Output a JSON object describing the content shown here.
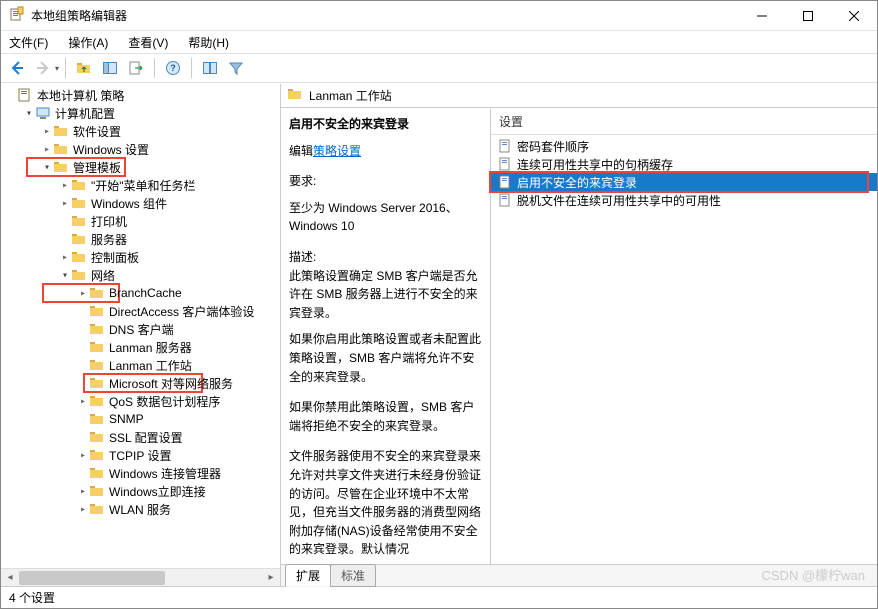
{
  "window": {
    "title": "本地组策略编辑器"
  },
  "menubar": {
    "file": "文件(F)",
    "action": "操作(A)",
    "view": "查看(V)",
    "help": "帮助(H)"
  },
  "tree": {
    "root": "本地计算机 策略",
    "computer_config": "计算机配置",
    "software_settings": "软件设置",
    "windows_settings": "Windows 设置",
    "admin_templates": "管理模板",
    "start_menu": "\"开始\"菜单和任务栏",
    "windows_components": "Windows 组件",
    "printers": "打印机",
    "server": "服务器",
    "control_panel": "控制面板",
    "network": "网络",
    "branchcache": "BranchCache",
    "directaccess": "DirectAccess 客户端体验设",
    "dns_client": "DNS 客户端",
    "lanman_server": "Lanman 服务器",
    "lanman_workstation": "Lanman 工作站",
    "microsoft_p2p": "Microsoft 对等网络服务",
    "qos": "QoS 数据包计划程序",
    "snmp": "SNMP",
    "ssl_config": "SSL 配置设置",
    "tcpip": "TCPIP 设置",
    "wcm": "Windows 连接管理器",
    "windows_now": "Windows立即连接",
    "wlan": "WLAN 服务"
  },
  "right": {
    "header": "Lanman 工作站",
    "setting_col": "设置",
    "items": {
      "cipher_order": "密码套件顺序",
      "ca_handle_cache": "连续可用性共享中的句柄缓存",
      "insecure_guest": "启用不安全的来宾登录",
      "offline_ca": "脱机文件在连续可用性共享中的可用性"
    },
    "tabs": {
      "extended": "扩展",
      "standard": "标准"
    }
  },
  "desc": {
    "title": "启用不安全的来宾登录",
    "edit_label": "编辑",
    "edit_link": "策略设置",
    "req_label": "要求:",
    "req_text": "至少为 Windows Server 2016、Windows 10",
    "desc_label": "描述:",
    "p1": "此策略设置确定 SMB 客户端是否允许在 SMB 服务器上进行不安全的来宾登录。",
    "p2": "如果你启用此策略设置或者未配置此策略设置，SMB 客户端将允许不安全的来宾登录。",
    "p3": "如果你禁用此策略设置，SMB 客户端将拒绝不安全的来宾登录。",
    "p4": "文件服务器使用不安全的来宾登录来允许对共享文件夹进行未经身份验证的访问。尽管在企业环境中不太常见，但充当文件服务器的消费型网络附加存储(NAS)设备经常使用不安全的来宾登录。默认情况"
  },
  "status": {
    "count": "4 个设置"
  },
  "watermark": "CSDN @檬柠wan"
}
